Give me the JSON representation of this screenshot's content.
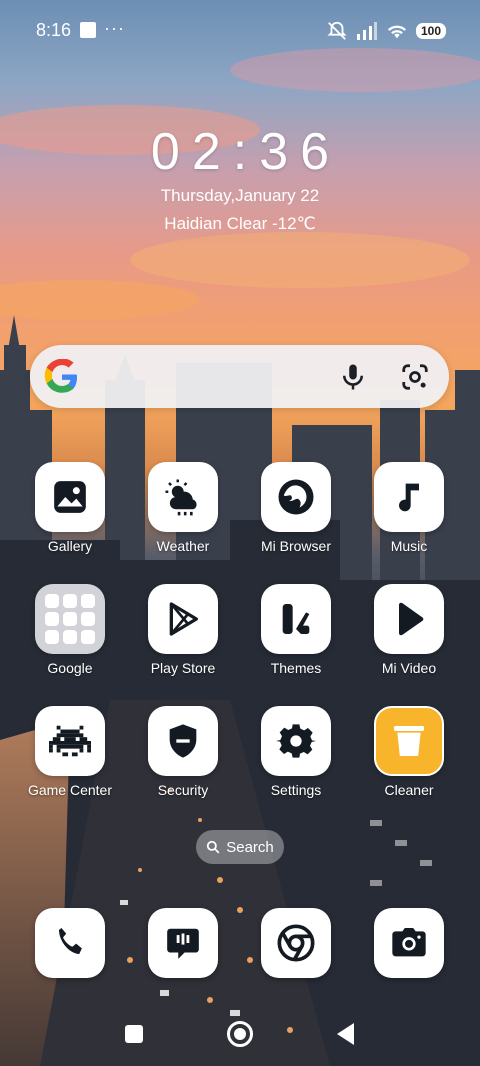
{
  "status_bar": {
    "time": "8:16",
    "dots": "···",
    "battery": "100"
  },
  "lockscreen": {
    "clock": "02:36",
    "date": "Thursday,January 22",
    "weather": "Haidian Clear -12℃"
  },
  "apps": [
    {
      "id": "gallery",
      "label": "Gallery",
      "icon": "gallery-icon"
    },
    {
      "id": "weather",
      "label": "Weather",
      "icon": "weather-icon"
    },
    {
      "id": "mi-browser",
      "label": "Mi Browser",
      "icon": "browser-icon"
    },
    {
      "id": "music",
      "label": "Music",
      "icon": "music-icon"
    },
    {
      "id": "google",
      "label": "Google",
      "icon": "folder-icon"
    },
    {
      "id": "play-store",
      "label": "Play Store",
      "icon": "play-store-icon"
    },
    {
      "id": "themes",
      "label": "Themes",
      "icon": "themes-icon"
    },
    {
      "id": "mi-video",
      "label": "Mi Video",
      "icon": "video-play-icon"
    },
    {
      "id": "game-center",
      "label": "Game Center",
      "icon": "game-icon"
    },
    {
      "id": "security",
      "label": "Security",
      "icon": "shield-icon"
    },
    {
      "id": "settings",
      "label": "Settings",
      "icon": "gear-icon"
    },
    {
      "id": "cleaner",
      "label": "Cleaner",
      "icon": "trash-icon"
    }
  ],
  "search_pill": {
    "label": "Search"
  },
  "dock": [
    {
      "id": "phone",
      "icon": "phone-icon"
    },
    {
      "id": "messages",
      "icon": "message-icon"
    },
    {
      "id": "chrome",
      "icon": "chrome-icon"
    },
    {
      "id": "camera",
      "icon": "camera-icon"
    }
  ],
  "colors": {
    "accent_yellow": "#f8b52c",
    "icon_dark": "#141a22",
    "tile": "#ffffff"
  }
}
